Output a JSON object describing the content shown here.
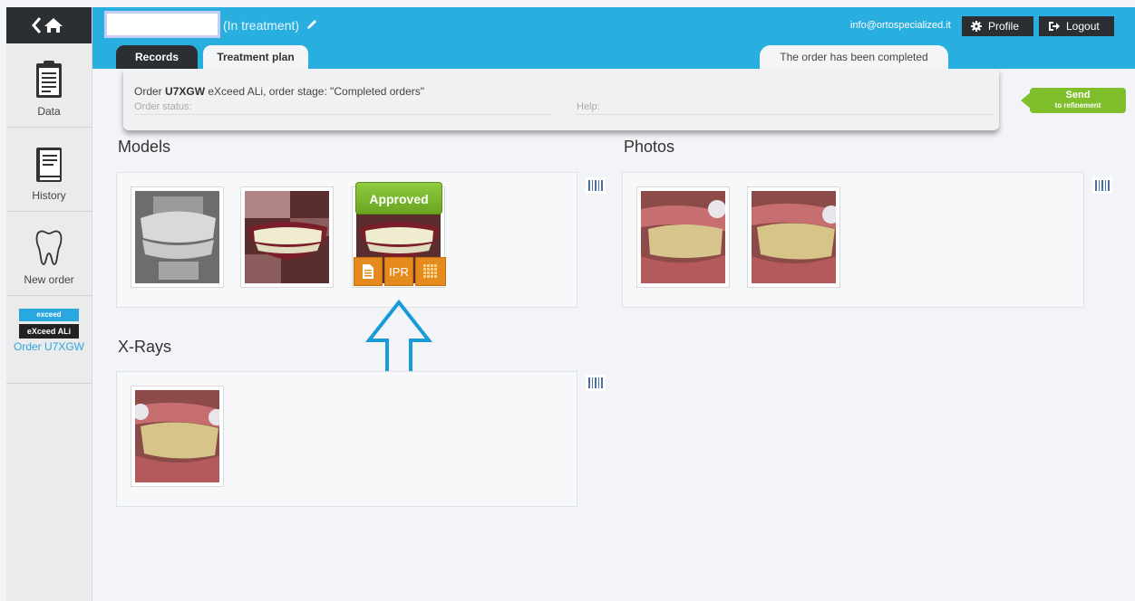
{
  "header": {
    "patient_status": "(In treatment)",
    "email": "info@ortospecialized.it",
    "profile_label": "Profile",
    "logout_label": "Logout",
    "tabs": [
      {
        "label": "Records"
      },
      {
        "label": "Treatment plan"
      }
    ],
    "completed_notice": "The order has been completed"
  },
  "sidebar": {
    "items": [
      {
        "label": "Data",
        "icon": "clipboard-icon"
      },
      {
        "label": "History",
        "icon": "book-icon"
      },
      {
        "label": "New order",
        "icon": "tooth-icon"
      }
    ],
    "order": {
      "badge_top": "exceed",
      "badge_bottom": "eXceed ALi",
      "label": "Order U7XGW"
    }
  },
  "info": {
    "order_prefix": "Order",
    "order_code": "U7XGW",
    "order_rest": " eXceed ALi, order stage: \"Completed orders\"",
    "status_label": "Order status:",
    "help_label": "Help:"
  },
  "send_button": {
    "main": "Send",
    "sub": "to refinement"
  },
  "sections": {
    "models": {
      "title": "Models",
      "approved_label": "Approved",
      "ipr_label": "IPR"
    },
    "photos": {
      "title": "Photos"
    },
    "xrays": {
      "title": "X-Rays"
    }
  },
  "colors": {
    "header_blue": "#29aee0",
    "dark": "#2b2f33",
    "green": "#7fbf2c",
    "orange": "#e58a1c"
  }
}
